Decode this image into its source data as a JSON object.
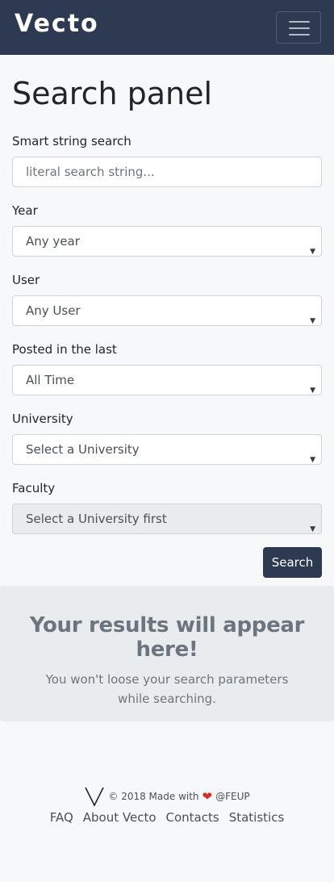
{
  "navbar": {
    "brand": "Vecto",
    "menu_icon": "hamburger-icon"
  },
  "page": {
    "title": "Search panel"
  },
  "form": {
    "smart_search": {
      "label": "Smart string search",
      "placeholder": "literal search string...",
      "value": ""
    },
    "year": {
      "label": "Year",
      "selected": "Any year"
    },
    "user": {
      "label": "User",
      "selected": "Any User"
    },
    "posted": {
      "label": "Posted in the last",
      "selected": "All Time"
    },
    "university": {
      "label": "University",
      "selected": "Select a University"
    },
    "faculty": {
      "label": "Faculty",
      "selected": "Select a University first",
      "disabled": true
    },
    "search_label": "Search"
  },
  "results": {
    "title": "Your results will appear here!",
    "text": "You won't loose your search parameters while searching."
  },
  "footer": {
    "copyright": "© 2018 Made with",
    "org": "@FEUP",
    "links": [
      "FAQ",
      "About Vecto",
      "Contacts",
      "Statistics"
    ]
  },
  "colors": {
    "navbar": "#2d3a52",
    "button": "#2d3a52",
    "results_bg": "#e9ecef",
    "heart": "#d32f2f"
  }
}
